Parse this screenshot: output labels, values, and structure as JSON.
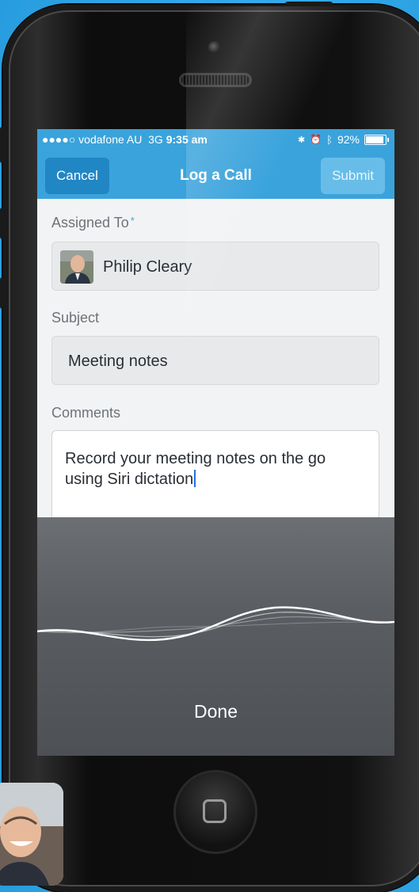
{
  "status_bar": {
    "carrier": "●●●●○ vodafone AU",
    "network": "3G",
    "time": "9:35 am",
    "battery": "92%",
    "battery_level": 0.92
  },
  "nav": {
    "cancel": "Cancel",
    "title": "Log a Call",
    "submit": "Submit"
  },
  "form": {
    "assigned_to": {
      "label": "Assigned To",
      "required_marker": "*",
      "value": "Philip Cleary"
    },
    "subject": {
      "label": "Subject",
      "value": "Meeting notes"
    },
    "comments": {
      "label": "Comments",
      "value": "Record your meeting notes on the go using Siri dictation"
    }
  },
  "dictation": {
    "done": "Done"
  },
  "colors": {
    "accent": "#3aa3dc",
    "background": "#2fa6e6"
  }
}
